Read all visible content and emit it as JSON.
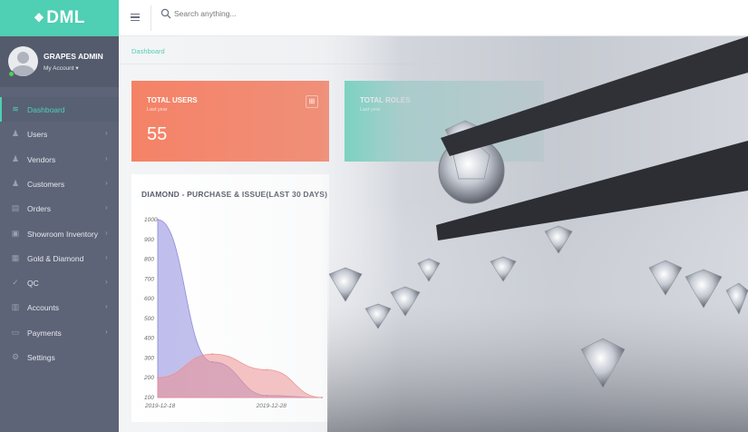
{
  "app": {
    "logo_text": "DML"
  },
  "user": {
    "name": "GRAPES ADMIN",
    "account_label": "My Account ▾"
  },
  "sidebar": {
    "items": [
      {
        "label": "Dashboard",
        "icon": "wifi-icon",
        "glyph": "≋",
        "active": true,
        "chevron": ""
      },
      {
        "label": "Users",
        "icon": "users-icon",
        "glyph": "♟",
        "active": false,
        "chevron": "›"
      },
      {
        "label": "Vendors",
        "icon": "vendors-icon",
        "glyph": "♟",
        "active": false,
        "chevron": "›"
      },
      {
        "label": "Customers",
        "icon": "customers-icon",
        "glyph": "♟",
        "active": false,
        "chevron": "›"
      },
      {
        "label": "Orders",
        "icon": "orders-icon",
        "glyph": "▤",
        "active": false,
        "chevron": "›"
      },
      {
        "label": "Showroom Inventory",
        "icon": "showroom-icon",
        "glyph": "▣",
        "active": false,
        "chevron": "›"
      },
      {
        "label": "Gold & Diamond",
        "icon": "gold-diamond-icon",
        "glyph": "▦",
        "active": false,
        "chevron": "›"
      },
      {
        "label": "QC",
        "icon": "qc-icon",
        "glyph": "✓",
        "active": false,
        "chevron": "›"
      },
      {
        "label": "Accounts",
        "icon": "accounts-icon",
        "glyph": "▥",
        "active": false,
        "chevron": "›"
      },
      {
        "label": "Payments",
        "icon": "payments-icon",
        "glyph": "▭",
        "active": false,
        "chevron": "›"
      },
      {
        "label": "Settings",
        "icon": "gear-icon",
        "glyph": "⚙",
        "active": false,
        "chevron": ""
      }
    ]
  },
  "search": {
    "placeholder": "Search anything..."
  },
  "breadcrumb": "Dashboard",
  "cards": {
    "total_users": {
      "title": "TOTAL USERS",
      "subtitle": "Last year",
      "value": "55"
    },
    "total_roles": {
      "title": "TOTAL ROLES",
      "subtitle": "Last year"
    }
  },
  "colors": {
    "accent": "#4fcfb3",
    "sidebar": "#5d6477",
    "card_orange": "#f48165",
    "purchase": "#8a86dc",
    "issue": "#ef8a8a"
  },
  "chart_data": {
    "type": "area",
    "title": "DIAMOND - PURCHASE & ISSUE(LAST 30 DAYS)",
    "x": [
      "2019-12-18",
      "2019-12-23",
      "2019-12-28",
      "2020-01-02"
    ],
    "x_tick_labels": [
      "2019-12-18",
      "2019-12-28"
    ],
    "yticks": [
      "1000",
      "900",
      "800",
      "700",
      "600",
      "500",
      "400",
      "300",
      "200",
      "100"
    ],
    "ylim": [
      100,
      1000
    ],
    "series": [
      {
        "color": "#8a86dc",
        "values": [
          1000,
          280,
          110,
          100
        ]
      },
      {
        "color": "#ef8a8a",
        "values": [
          200,
          320,
          240,
          100
        ]
      }
    ]
  }
}
